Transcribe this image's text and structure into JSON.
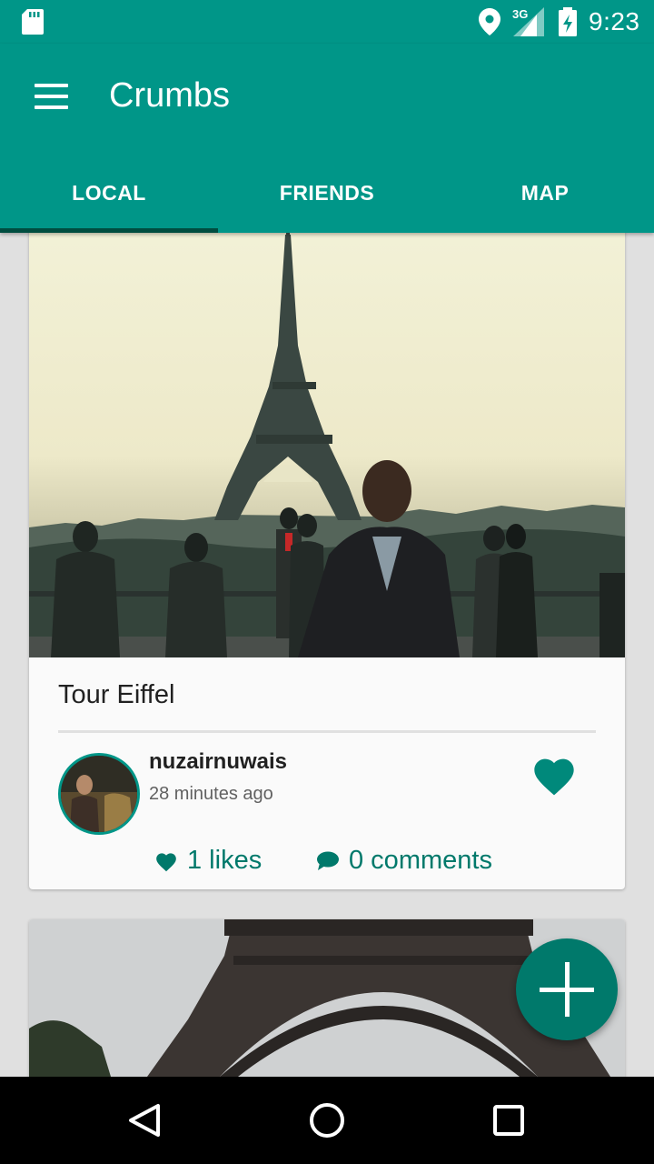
{
  "status_bar": {
    "network": "3G",
    "time": "9:23",
    "icons": [
      "sd-card-icon",
      "location-icon",
      "signal-icon",
      "battery-charging-icon"
    ]
  },
  "app_bar": {
    "title": "Crumbs",
    "menu_icon": "hamburger-menu-icon",
    "tabs": [
      {
        "label": "LOCAL",
        "selected": true
      },
      {
        "label": "FRIENDS",
        "selected": false
      },
      {
        "label": "MAP",
        "selected": false
      }
    ]
  },
  "posts": [
    {
      "title": "Tour Eiffel",
      "username": "nuzairnuwais",
      "time_ago": "28 minutes ago",
      "likes": "1 likes",
      "comments": "0 comments",
      "liked": true
    }
  ],
  "fab": {
    "icon": "add-icon"
  },
  "nav_bar": {
    "icons": [
      "back-icon",
      "home-icon",
      "recents-icon"
    ]
  },
  "colors": {
    "primary": "#009688",
    "primary_dark": "#00796b",
    "indicator": "#004d40",
    "card_bg": "#fafafa",
    "page_bg": "#e0e0e0"
  }
}
